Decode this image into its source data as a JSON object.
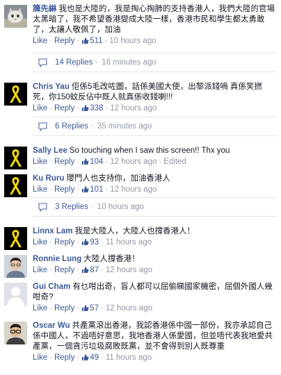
{
  "comments": [
    {
      "id": "c1",
      "author": "簰先綝",
      "text": "我也是大陸的，我是掏心掏肺的支持香港人，我們大陸的官場太黑暗了，我不希望香港變成大陸一樣，香港市民和學生都太勇敢了，太讓人敬佩了，加油",
      "like": "Like",
      "reply": "Reply",
      "likes": "511",
      "time": "10 hours ago",
      "avatar_icon": "cat-photo-avatar",
      "replies": {
        "label": "14 Replies",
        "time": "16 minutes ago"
      }
    },
    {
      "id": "c2",
      "author": "Chris Yau",
      "text": "佢係5毛改咗圖，話係美國大使，出黎派錢喎 真係笑撚死，你150蚊反佔中既人就真係收錢喇!!!",
      "like": "Like",
      "reply": "Reply",
      "likes": "338",
      "time": "12 hours ago",
      "avatar_icon": "yellow-ribbon-avatar",
      "replies": {
        "label": "6 Replies",
        "time": "35 minutes ago"
      }
    },
    {
      "id": "c3",
      "author": "Sally Lee",
      "text": "So touching when I saw this screen!! Thx you",
      "like": "Like",
      "reply": "Reply",
      "likes": "104",
      "time": "12 hours ago",
      "edited": "Edited",
      "avatar_icon": "yellow-ribbon-avatar"
    },
    {
      "id": "c4",
      "author": "Ku Ruru",
      "text": "瓔門人也支持你，加油香港人",
      "like": "Like",
      "reply": "Reply",
      "likes": "101",
      "time": "12 hours ago",
      "avatar_icon": "yellow-ribbon-avatar",
      "replies": {
        "label": "3 Replies",
        "time": "10 hours ago"
      }
    },
    {
      "id": "c5",
      "author": "Linnx Lam",
      "text": "我是大陸人，大陸人也撐香港人！",
      "like": "Like",
      "reply": "Reply",
      "likes": "93",
      "time": "11 hours ago",
      "avatar_icon": "yellow-ribbon-avatar"
    },
    {
      "id": "c6",
      "author": "Ronnie Lung",
      "text": "大陸人撐香港！",
      "like": "Like",
      "reply": "Reply",
      "likes": "87",
      "time": "12 hours ago",
      "avatar_icon": "person-photo-avatar"
    },
    {
      "id": "c7",
      "author": "Gui Cham",
      "text": "有乜咁出奇，盲人都可以屈偷睇國家機密，屈個外國人幾咁奇?",
      "like": "Like",
      "reply": "Reply",
      "likes": "57",
      "time": "12 hours ago",
      "avatar_icon": "default-silhouette-avatar"
    },
    {
      "id": "c8",
      "author": "Oscar Wu",
      "text": "共產黨滾出香港，我認香港係中國一部份，我亦承認自己係中國人，不過唔好意思，我地香港人係愛國，但並唔代表我地愛共產黨，一個貪污垃圾腐敗既黨，並不會得到別人既尊重",
      "like": "Like",
      "reply": "Reply",
      "likes": "49",
      "time": "11 hours ago",
      "avatar_icon": "glasses-person-avatar"
    }
  ],
  "colors": {
    "link": "#3b5998",
    "meta": "#9197a3",
    "ribbon": "#f5d90a",
    "ribbon_bg": "#000000"
  }
}
